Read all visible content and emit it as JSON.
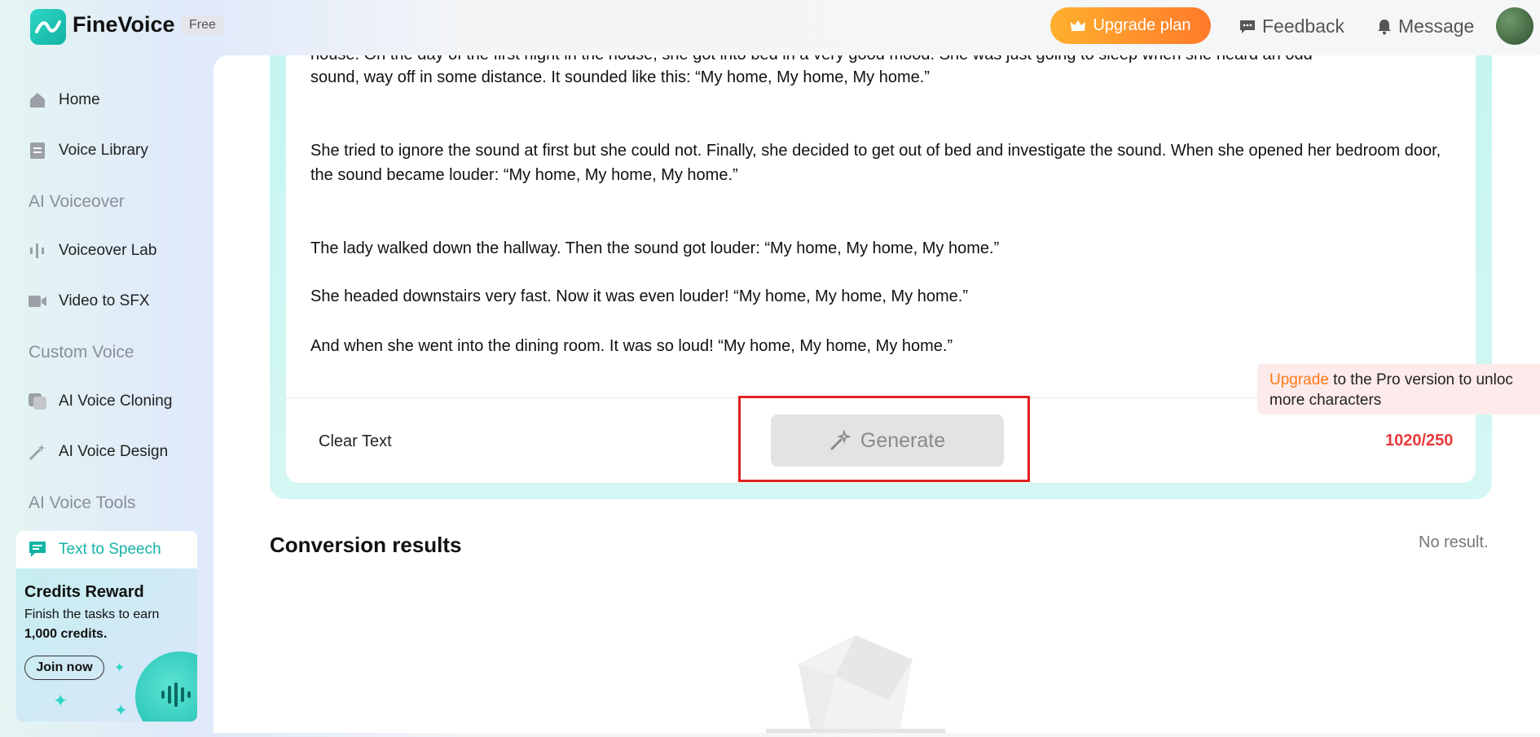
{
  "header": {
    "brand": "FineVoice",
    "badge": "Free",
    "upgrade_label": "Upgrade plan",
    "feedback_label": "Feedback",
    "message_label": "Message"
  },
  "sidebar": {
    "items": [
      {
        "label": "Home",
        "icon": "home-icon"
      },
      {
        "label": "Voice Library",
        "icon": "library-icon"
      },
      {
        "label": "Voiceover Lab",
        "icon": "waveform-icon"
      },
      {
        "label": "Video to SFX",
        "icon": "video-icon"
      },
      {
        "label": "AI Voice Cloning",
        "icon": "clone-icon"
      },
      {
        "label": "AI Voice Design",
        "icon": "magic-wand-icon"
      },
      {
        "label": "Text to Speech",
        "icon": "chat-icon"
      }
    ],
    "sections": [
      "AI Voiceover",
      "Custom Voice",
      "AI Voice Tools"
    ],
    "credits": {
      "title": "Credits Reward",
      "line1": "Finish the tasks to earn",
      "line2": "1,000 credits.",
      "button": "Join now"
    }
  },
  "editor": {
    "partial_top": "house. On the day of the first night in the house, she got into bed in a very good mood. She was just going to sleep when she heard an odd",
    "p1": "sound, way off in some distance. It sounded like this: “My home, My home, My home.”",
    "p2": "She tried to ignore the sound at first but she could not. Finally, she decided to get out of bed and investigate the sound.  When she opened her bedroom door, the sound became louder: “My home, My home, My home.”",
    "p3": "The lady walked down the hallway. Then the sound got louder: “My home, My home, My home.”",
    "p4": "She headed downstairs very fast. Now it was even louder! “My home, My home, My home.”",
    "p5": "And when she went into the dining room. It was so loud! “My home, My home, My home.”",
    "clear_label": "Clear Text",
    "generate_label": "Generate",
    "char_count": "1020/250",
    "tip_upgrade": "Upgrade",
    "tip_rest": " to the Pro version to unloc",
    "tip_line2": "more characters"
  },
  "results": {
    "title": "Conversion results",
    "empty": "No result."
  },
  "colors": {
    "accent": "#14b3a4",
    "upgrade": "#ff8a2a",
    "error": "#e93a3a",
    "highlight": "#e02020"
  }
}
